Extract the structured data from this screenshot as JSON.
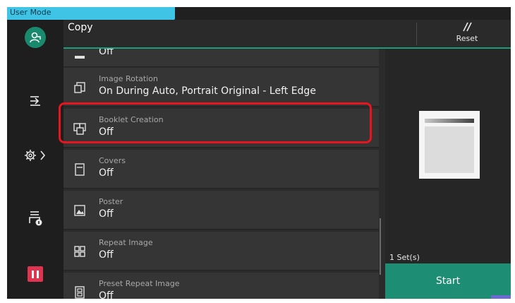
{
  "status": {
    "user_mode": "User Mode"
  },
  "header": {
    "title": "Copy",
    "reset_label": "Reset"
  },
  "rail": {
    "avatar_icon": "user-icon",
    "login_icon": "login-arrow-icon",
    "settings_icon": "gear-icon",
    "job_status_icon": "printer-info-icon",
    "stop_icon": "pause-icon"
  },
  "features": [
    {
      "label": "",
      "value": "Off",
      "icon": "dash-icon"
    },
    {
      "label": "Image Rotation",
      "value": "On During Auto, Portrait Original - Left Edge",
      "icon": "image-rotation-icon"
    },
    {
      "label": "Booklet Creation",
      "value": "Off",
      "icon": "booklet-icon"
    },
    {
      "label": "Covers",
      "value": "Off",
      "icon": "covers-icon"
    },
    {
      "label": "Poster",
      "value": "Off",
      "icon": "poster-icon"
    },
    {
      "label": "Repeat Image",
      "value": "Off",
      "icon": "repeat-image-icon"
    },
    {
      "label": "Preset Repeat Image",
      "value": "Off",
      "icon": "preset-repeat-image-icon"
    }
  ],
  "preview": {
    "sets_label": "1 Set(s)"
  },
  "actions": {
    "start_label": "Start"
  },
  "colors": {
    "accent": "#1d8d73",
    "highlight": "#e8141e",
    "user_mode_tab": "#40c4e6",
    "stop": "#e0334f"
  }
}
